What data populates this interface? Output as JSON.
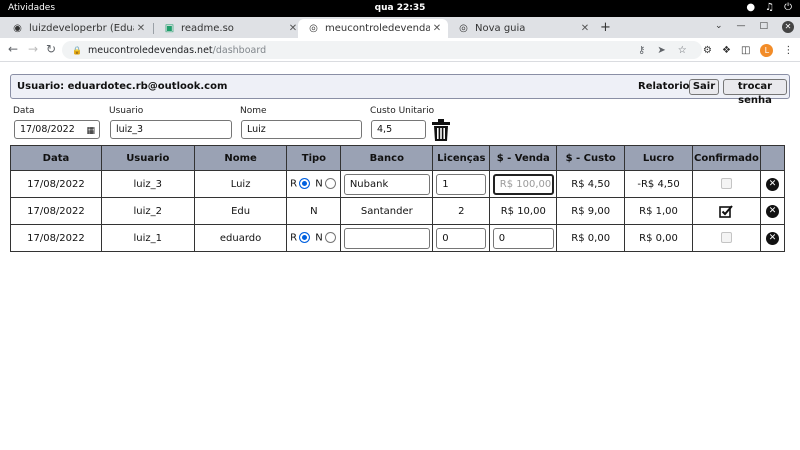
{
  "topbar": {
    "activities": "Atividades",
    "clock": "qua 22:35"
  },
  "tabs": [
    {
      "title": "luizdeveloperbr (Eduardo",
      "icon": "github-icon"
    },
    {
      "title": "readme.so",
      "icon": "readme-icon"
    },
    {
      "title": "meucontroledevendas.net",
      "icon": "globe-icon"
    },
    {
      "title": "Nova guia",
      "icon": "globe-icon"
    }
  ],
  "address": {
    "host": "meucontroledevendas.net",
    "path": "/dashboard"
  },
  "userbar": {
    "user_label": "Usuario: eduardotec.rb@outlook.com",
    "reports": "Relatorios",
    "logout": "Sair",
    "change_password": "trocar senha"
  },
  "form": {
    "date_label": "Data",
    "date_value": "17/08/2022",
    "user_label": "Usuario",
    "user_value": "luiz_3",
    "name_label": "Nome",
    "name_value": "Luiz",
    "cost_label": "Custo Unitario",
    "cost_value": "4,5"
  },
  "table": {
    "headers": [
      "Data",
      "Usuario",
      "Nome",
      "Tipo",
      "Banco",
      "Licenças",
      "$ - Venda",
      "$ - Custo",
      "Lucro",
      "Confirmado",
      ""
    ],
    "rows": [
      {
        "date": "17/08/2022",
        "user": "luiz_3",
        "name": "Luiz",
        "tipo_r": "R",
        "tipo_n": "N",
        "bank": "Nubank",
        "licenses": "1",
        "sale": "R$ 100,00",
        "cost": "R$ 4,50",
        "profit": "-R$ 4,50"
      },
      {
        "date": "17/08/2022",
        "user": "luiz_2",
        "name": "Edu",
        "tipo": "N",
        "bank": "Santander",
        "licenses": "2",
        "sale": "R$ 10,00",
        "cost": "R$ 9,00",
        "profit": "R$ 1,00"
      },
      {
        "date": "17/08/2022",
        "user": "luiz_1",
        "name": "eduardo",
        "tipo_r": "R",
        "tipo_n": "N",
        "bank": "",
        "licenses": "0",
        "sale": "0",
        "cost": "R$ 0,00",
        "profit": "R$ 0,00"
      }
    ]
  },
  "colors": {
    "header_bg": "#9aa2b4",
    "userbar_bg": "#eef0f7",
    "radio_accent": "#0060df"
  }
}
